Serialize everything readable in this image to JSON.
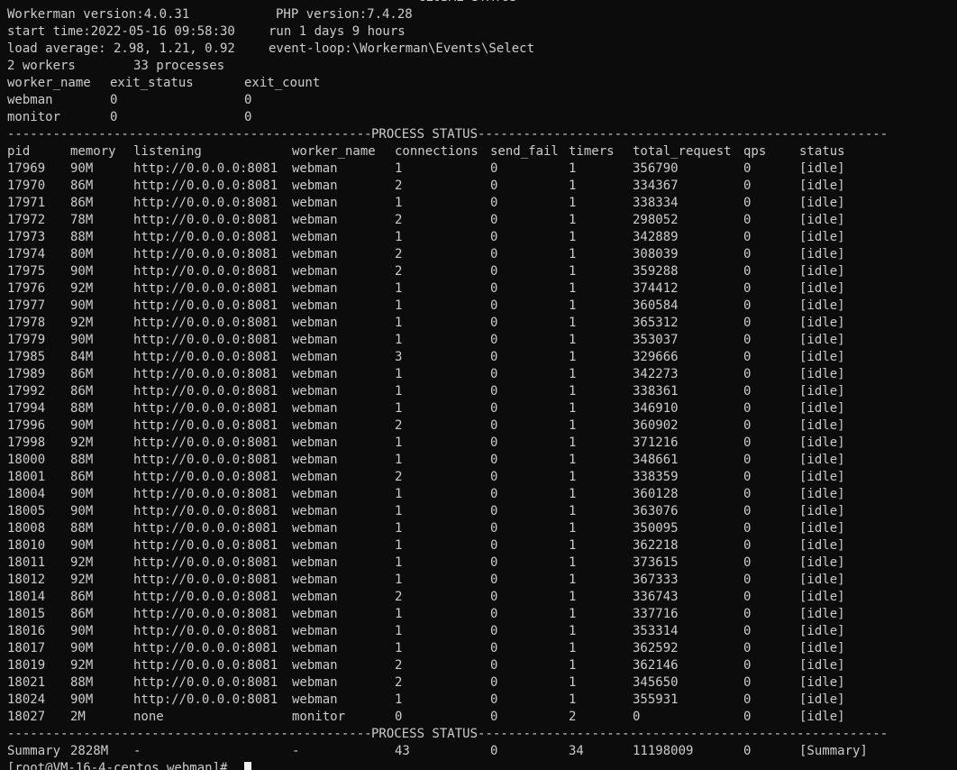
{
  "global": {
    "title": "GLOBAL STATUS",
    "workerman_version": "Workerman version:4.0.31",
    "php_version": "PHP version:7.4.28",
    "start_time": "start time:2022-05-16 09:58:30",
    "run_time": "run 1 days 9 hours",
    "load_average": "load average: 2.98, 1.21, 0.92",
    "event_loop": "event-loop:\\Workerman\\Events\\Select",
    "workers": "2 workers",
    "processes": "33 processes",
    "worker_headers": [
      "worker_name",
      "exit_status",
      "exit_count"
    ],
    "worker_rows": [
      [
        "webman",
        "0",
        "0"
      ],
      [
        "monitor",
        "0",
        "0"
      ]
    ]
  },
  "process": {
    "title": "PROCESS STATUS",
    "headers": [
      "pid",
      "memory",
      "listening",
      "worker_name",
      "connections",
      "send_fail",
      "timers",
      "total_request",
      "qps",
      "status"
    ],
    "rows": [
      [
        "17969",
        "90M",
        "http://0.0.0.0:8081",
        "webman",
        "1",
        "0",
        "1",
        "356790",
        "0",
        "[idle]"
      ],
      [
        "17970",
        "86M",
        "http://0.0.0.0:8081",
        "webman",
        "2",
        "0",
        "1",
        "334367",
        "0",
        "[idle]"
      ],
      [
        "17971",
        "86M",
        "http://0.0.0.0:8081",
        "webman",
        "1",
        "0",
        "1",
        "338334",
        "0",
        "[idle]"
      ],
      [
        "17972",
        "78M",
        "http://0.0.0.0:8081",
        "webman",
        "2",
        "0",
        "1",
        "298052",
        "0",
        "[idle]"
      ],
      [
        "17973",
        "88M",
        "http://0.0.0.0:8081",
        "webman",
        "1",
        "0",
        "1",
        "342889",
        "0",
        "[idle]"
      ],
      [
        "17974",
        "80M",
        "http://0.0.0.0:8081",
        "webman",
        "2",
        "0",
        "1",
        "308039",
        "0",
        "[idle]"
      ],
      [
        "17975",
        "90M",
        "http://0.0.0.0:8081",
        "webman",
        "2",
        "0",
        "1",
        "359288",
        "0",
        "[idle]"
      ],
      [
        "17976",
        "92M",
        "http://0.0.0.0:8081",
        "webman",
        "1",
        "0",
        "1",
        "374412",
        "0",
        "[idle]"
      ],
      [
        "17977",
        "90M",
        "http://0.0.0.0:8081",
        "webman",
        "1",
        "0",
        "1",
        "360584",
        "0",
        "[idle]"
      ],
      [
        "17978",
        "92M",
        "http://0.0.0.0:8081",
        "webman",
        "1",
        "0",
        "1",
        "365312",
        "0",
        "[idle]"
      ],
      [
        "17979",
        "90M",
        "http://0.0.0.0:8081",
        "webman",
        "1",
        "0",
        "1",
        "353037",
        "0",
        "[idle]"
      ],
      [
        "17985",
        "84M",
        "http://0.0.0.0:8081",
        "webman",
        "3",
        "0",
        "1",
        "329666",
        "0",
        "[idle]"
      ],
      [
        "17989",
        "86M",
        "http://0.0.0.0:8081",
        "webman",
        "1",
        "0",
        "1",
        "342273",
        "0",
        "[idle]"
      ],
      [
        "17992",
        "86M",
        "http://0.0.0.0:8081",
        "webman",
        "1",
        "0",
        "1",
        "338361",
        "0",
        "[idle]"
      ],
      [
        "17994",
        "88M",
        "http://0.0.0.0:8081",
        "webman",
        "1",
        "0",
        "1",
        "346910",
        "0",
        "[idle]"
      ],
      [
        "17996",
        "90M",
        "http://0.0.0.0:8081",
        "webman",
        "2",
        "0",
        "1",
        "360902",
        "0",
        "[idle]"
      ],
      [
        "17998",
        "92M",
        "http://0.0.0.0:8081",
        "webman",
        "1",
        "0",
        "1",
        "371216",
        "0",
        "[idle]"
      ],
      [
        "18000",
        "88M",
        "http://0.0.0.0:8081",
        "webman",
        "1",
        "0",
        "1",
        "348661",
        "0",
        "[idle]"
      ],
      [
        "18001",
        "86M",
        "http://0.0.0.0:8081",
        "webman",
        "2",
        "0",
        "1",
        "338359",
        "0",
        "[idle]"
      ],
      [
        "18004",
        "90M",
        "http://0.0.0.0:8081",
        "webman",
        "1",
        "0",
        "1",
        "360128",
        "0",
        "[idle]"
      ],
      [
        "18005",
        "90M",
        "http://0.0.0.0:8081",
        "webman",
        "1",
        "0",
        "1",
        "363076",
        "0",
        "[idle]"
      ],
      [
        "18008",
        "88M",
        "http://0.0.0.0:8081",
        "webman",
        "1",
        "0",
        "1",
        "350095",
        "0",
        "[idle]"
      ],
      [
        "18010",
        "90M",
        "http://0.0.0.0:8081",
        "webman",
        "1",
        "0",
        "1",
        "362218",
        "0",
        "[idle]"
      ],
      [
        "18011",
        "92M",
        "http://0.0.0.0:8081",
        "webman",
        "1",
        "0",
        "1",
        "373615",
        "0",
        "[idle]"
      ],
      [
        "18012",
        "92M",
        "http://0.0.0.0:8081",
        "webman",
        "1",
        "0",
        "1",
        "367333",
        "0",
        "[idle]"
      ],
      [
        "18014",
        "86M",
        "http://0.0.0.0:8081",
        "webman",
        "2",
        "0",
        "1",
        "336743",
        "0",
        "[idle]"
      ],
      [
        "18015",
        "86M",
        "http://0.0.0.0:8081",
        "webman",
        "1",
        "0",
        "1",
        "337716",
        "0",
        "[idle]"
      ],
      [
        "18016",
        "90M",
        "http://0.0.0.0:8081",
        "webman",
        "1",
        "0",
        "1",
        "353314",
        "0",
        "[idle]"
      ],
      [
        "18017",
        "90M",
        "http://0.0.0.0:8081",
        "webman",
        "1",
        "0",
        "1",
        "362592",
        "0",
        "[idle]"
      ],
      [
        "18019",
        "92M",
        "http://0.0.0.0:8081",
        "webman",
        "2",
        "0",
        "1",
        "362146",
        "0",
        "[idle]"
      ],
      [
        "18021",
        "88M",
        "http://0.0.0.0:8081",
        "webman",
        "2",
        "0",
        "1",
        "345650",
        "0",
        "[idle]"
      ],
      [
        "18024",
        "90M",
        "http://0.0.0.0:8081",
        "webman",
        "1",
        "0",
        "1",
        "355931",
        "0",
        "[idle]"
      ],
      [
        "18027",
        "2M",
        "none",
        "monitor",
        "0",
        "0",
        "2",
        "0",
        "0",
        "[idle]"
      ]
    ],
    "summary": [
      "Summary",
      "2828M",
      "-",
      "-",
      "43",
      "0",
      "34",
      "11198009",
      "0",
      "[Summary]"
    ]
  },
  "prompt": {
    "text": "[root@VM-16-4-centos webman]# "
  },
  "colors": {
    "background": "#0c0c0c",
    "foreground": "#cccccc",
    "cursor": "#f2f2f2"
  }
}
